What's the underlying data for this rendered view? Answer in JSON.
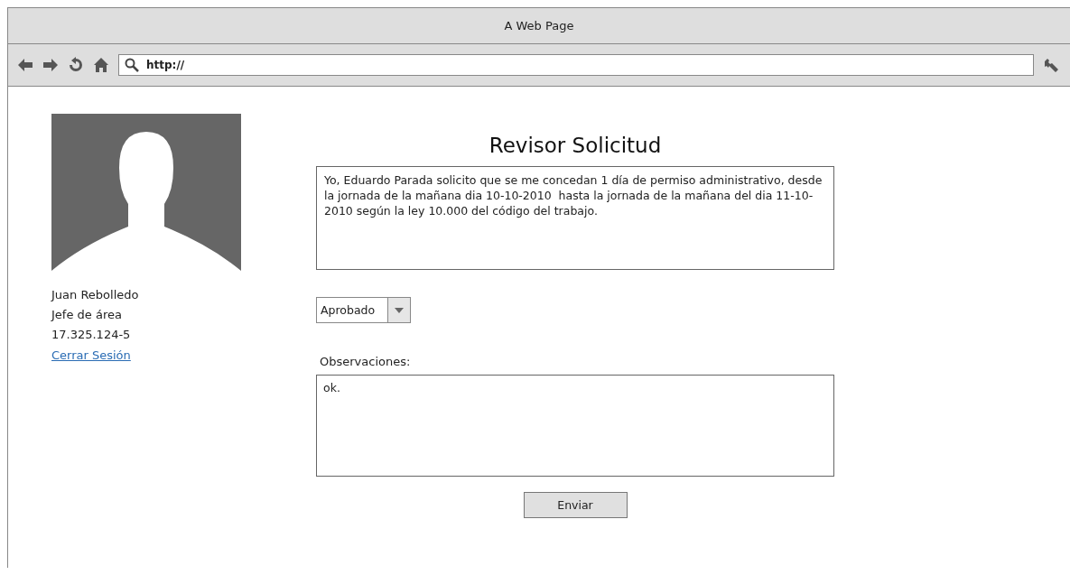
{
  "window": {
    "title": "A Web Page"
  },
  "toolbar": {
    "url": "http://"
  },
  "profile": {
    "name": "Juan Rebolledo",
    "role": "Jefe de área",
    "id_number": "17.325.124-5",
    "logout_link": "Cerrar Sesión"
  },
  "form": {
    "title": "Revisor Solicitud",
    "request_text": "Yo, Eduardo Parada solicito que se me concedan 1 día de permiso administrativo, desde la jornada de la mañana dia 10-10-2010  hasta la jornada de la mañana del dia 11-10-2010 según la ley 10.000 del código del trabajo.",
    "status_dropdown": {
      "value": "Aprobado"
    },
    "observations_label": "Observaciones:",
    "observations": {
      "value": "ok."
    },
    "submit_button": "Enviar"
  }
}
